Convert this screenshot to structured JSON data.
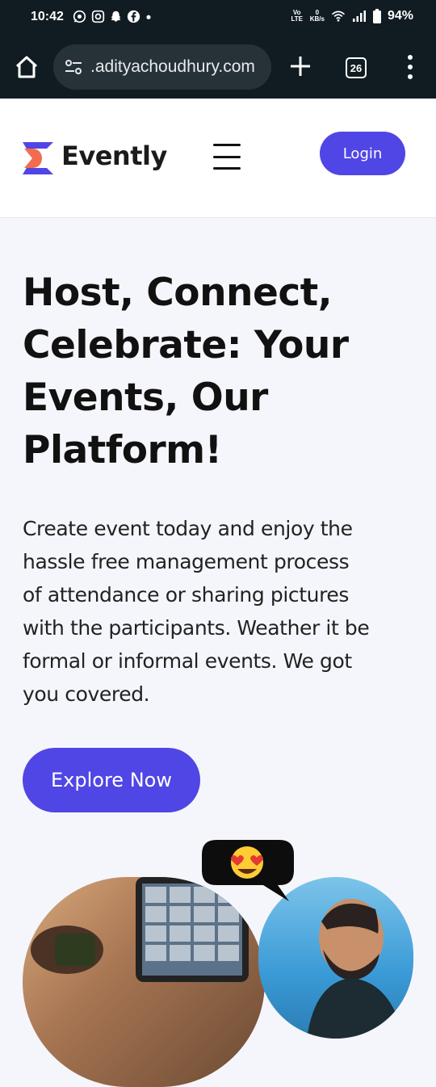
{
  "status_bar": {
    "time": "10:42",
    "left_icons": [
      "whatsapp-icon",
      "instagram-icon",
      "snapchat-icon",
      "facebook-icon",
      "dot-icon"
    ],
    "volte_label": "Vo LTE",
    "net_speed_value": "0",
    "net_speed_unit": "KB/s",
    "battery": "94%"
  },
  "browser": {
    "url": ".adityachoudhury.com",
    "tab_count": "26"
  },
  "header": {
    "brand": "Evently",
    "login_label": "Login"
  },
  "hero": {
    "title_lines": [
      "Host, Connect,",
      "Celebrate: Your",
      "Events, Our",
      "Platform!"
    ],
    "description_lines": [
      "Create event today and enjoy the",
      "hassle free management process",
      "of attendance or sharing pictures",
      "with the participants. Weather it be",
      "formal or informal events. We got",
      "you covered."
    ],
    "cta_label": "Explore Now"
  },
  "colors": {
    "accent": "#5046e5",
    "logo_orange": "#f26d4f",
    "logo_purple": "#5046e5",
    "background": "#f5f6fb"
  }
}
